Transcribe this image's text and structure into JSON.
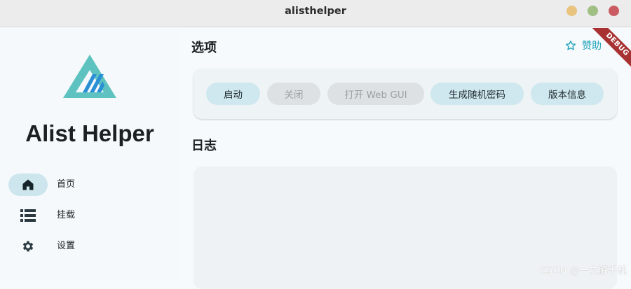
{
  "window": {
    "title": "alisthelper"
  },
  "sidebar": {
    "app_name": "Alist Helper",
    "items": [
      {
        "label": "首页",
        "icon": "home-icon",
        "active": true
      },
      {
        "label": "挂载",
        "icon": "storage-list-icon",
        "active": false
      },
      {
        "label": "设置",
        "icon": "gear-icon",
        "active": false
      }
    ]
  },
  "main": {
    "options_title": "选项",
    "donate_label": "赞助",
    "buttons": [
      {
        "label": "启动",
        "enabled": true
      },
      {
        "label": "关闭",
        "enabled": false
      },
      {
        "label": "打开 Web GUI",
        "enabled": false
      },
      {
        "label": "生成随机密码",
        "enabled": true
      },
      {
        "label": "版本信息",
        "enabled": true
      }
    ],
    "log_title": "日志"
  },
  "debug_banner": "DEBUG",
  "watermark": "CSDN @一文解千机",
  "colors": {
    "accent": "#1a9fb8",
    "active_pill": "#cde6ee",
    "button_enabled": "#cfe7ee",
    "button_disabled": "#dde1e3",
    "debug_ribbon": "#a83232"
  }
}
